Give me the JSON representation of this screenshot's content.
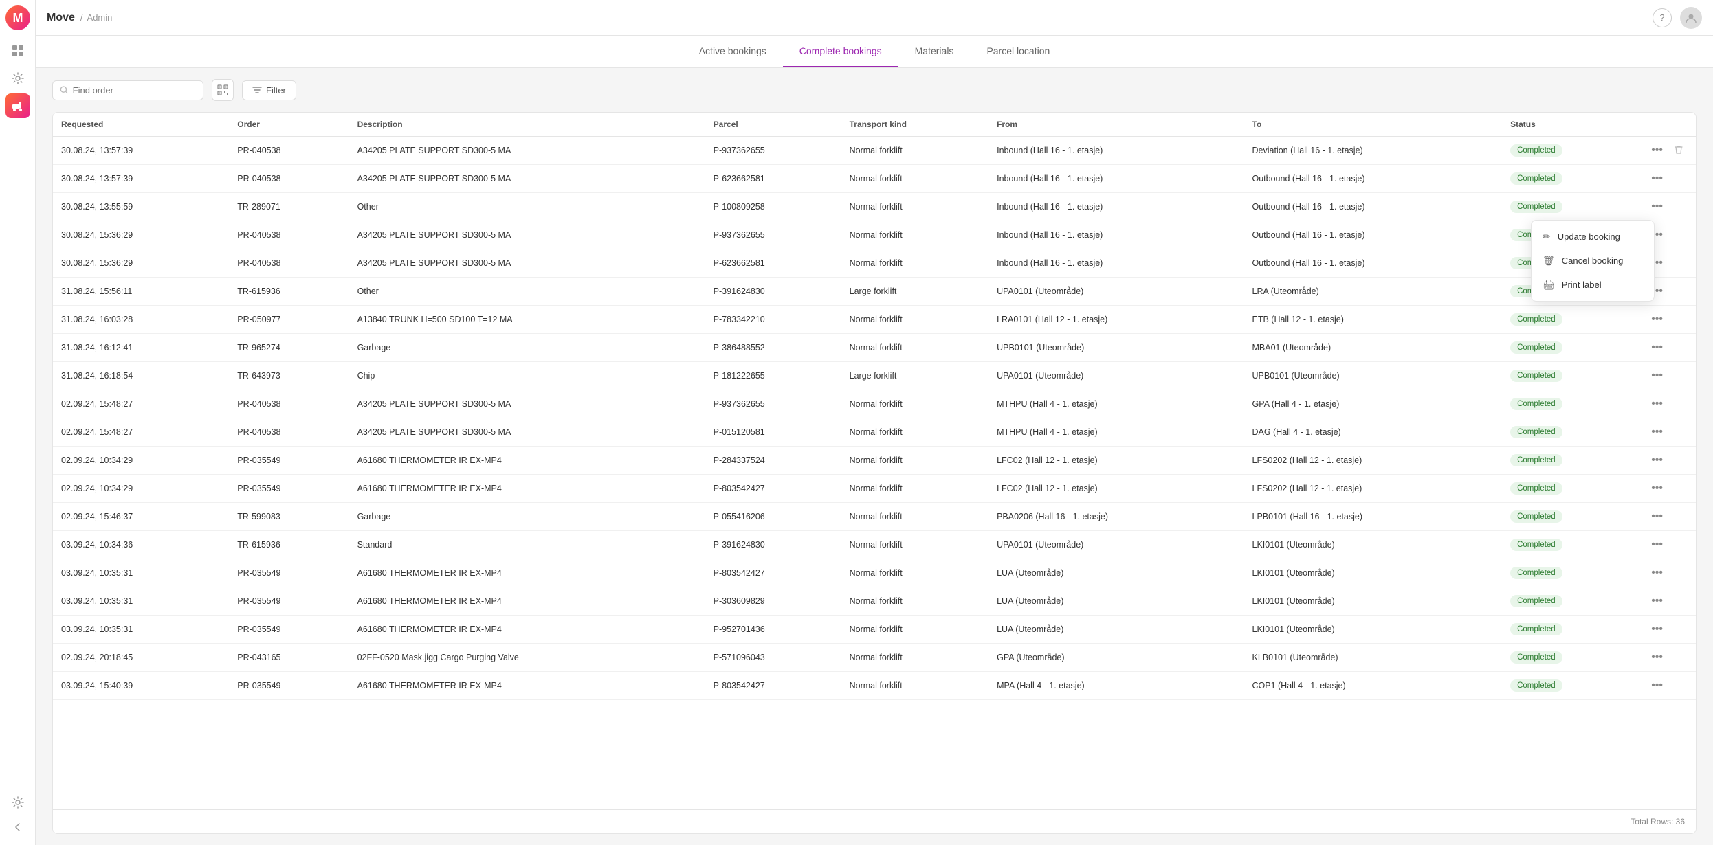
{
  "app": {
    "name": "Move",
    "breadcrumb_sep": "/",
    "breadcrumb": "Admin"
  },
  "sidebar": {
    "logo_alt": "Move logo",
    "icons": [
      {
        "name": "grid-icon",
        "symbol": "⊞",
        "active": false
      },
      {
        "name": "settings-icon",
        "symbol": "⚙",
        "active": false
      },
      {
        "name": "forklift-icon",
        "symbol": "🏗",
        "active": true
      },
      {
        "name": "gear-bottom-icon",
        "symbol": "⚙",
        "active": false
      },
      {
        "name": "collapse-icon",
        "symbol": "‹",
        "active": false
      }
    ]
  },
  "topbar": {
    "help_icon": "?",
    "user_icon": "👤"
  },
  "nav": {
    "tabs": [
      {
        "id": "active",
        "label": "Active bookings",
        "active": false
      },
      {
        "id": "complete",
        "label": "Complete bookings",
        "active": true
      },
      {
        "id": "materials",
        "label": "Materials",
        "active": false
      },
      {
        "id": "parcel",
        "label": "Parcel location",
        "active": false
      }
    ]
  },
  "toolbar": {
    "search_placeholder": "Find order",
    "filter_label": "Filter",
    "qr_title": "QR"
  },
  "table": {
    "columns": [
      "Requested",
      "Order",
      "Description",
      "Parcel",
      "Transport kind",
      "From",
      "To",
      "Status"
    ],
    "rows": [
      {
        "requested": "30.08.24, 13:57:39",
        "order": "PR-040538",
        "description": "A34205 PLATE SUPPORT SD300-5 MA",
        "parcel": "P-937362655",
        "transport": "Normal forklift",
        "from": "Inbound (Hall 16 - 1. etasje)",
        "to": "Deviation (Hall 16 - 1. etasje)",
        "status": "Completed",
        "menu_open": true
      },
      {
        "requested": "30.08.24, 13:57:39",
        "order": "PR-040538",
        "description": "A34205 PLATE SUPPORT SD300-5 MA",
        "parcel": "P-623662581",
        "transport": "Normal forklift",
        "from": "Inbound (Hall 16 - 1. etasje)",
        "to": "Outbound (Hall 16 - 1. etasje)",
        "status": "Completed",
        "menu_open": false
      },
      {
        "requested": "30.08.24, 13:55:59",
        "order": "TR-289071",
        "description": "Other",
        "parcel": "P-100809258",
        "transport": "Normal forklift",
        "from": "Inbound (Hall 16 - 1. etasje)",
        "to": "Outbound (Hall 16 - 1. etasje)",
        "status": "Completed",
        "menu_open": false
      },
      {
        "requested": "30.08.24, 15:36:29",
        "order": "PR-040538",
        "description": "A34205 PLATE SUPPORT SD300-5 MA",
        "parcel": "P-937362655",
        "transport": "Normal forklift",
        "from": "Inbound (Hall 16 - 1. etasje)",
        "to": "Outbound (Hall 16 - 1. etasje)",
        "status": "Completed",
        "menu_open": false
      },
      {
        "requested": "30.08.24, 15:36:29",
        "order": "PR-040538",
        "description": "A34205 PLATE SUPPORT SD300-5 MA",
        "parcel": "P-623662581",
        "transport": "Normal forklift",
        "from": "Inbound (Hall 16 - 1. etasje)",
        "to": "Outbound (Hall 16 - 1. etasje)",
        "status": "Completed",
        "menu_open": false
      },
      {
        "requested": "31.08.24, 15:56:11",
        "order": "TR-615936",
        "description": "Other",
        "parcel": "P-391624830",
        "transport": "Large forklift",
        "from": "UPA0101 (Uteområde)",
        "to": "LRA (Uteområde)",
        "status": "Completed",
        "menu_open": false
      },
      {
        "requested": "31.08.24, 16:03:28",
        "order": "PR-050977",
        "description": "A13840 TRUNK H=500 SD100 T=12 MA",
        "parcel": "P-783342210",
        "transport": "Normal forklift",
        "from": "LRA0101 (Hall 12 - 1. etasje)",
        "to": "ETB (Hall 12 - 1. etasje)",
        "status": "Completed",
        "menu_open": false
      },
      {
        "requested": "31.08.24, 16:12:41",
        "order": "TR-965274",
        "description": "Garbage",
        "parcel": "P-386488552",
        "transport": "Normal forklift",
        "from": "UPB0101 (Uteområde)",
        "to": "MBA01 (Uteområde)",
        "status": "Completed",
        "menu_open": false
      },
      {
        "requested": "31.08.24, 16:18:54",
        "order": "TR-643973",
        "description": "Chip",
        "parcel": "P-181222655",
        "transport": "Large forklift",
        "from": "UPA0101 (Uteområde)",
        "to": "UPB0101 (Uteområde)",
        "status": "Completed",
        "menu_open": false
      },
      {
        "requested": "02.09.24, 15:48:27",
        "order": "PR-040538",
        "description": "A34205 PLATE SUPPORT SD300-5 MA",
        "parcel": "P-937362655",
        "transport": "Normal forklift",
        "from": "MTHPU (Hall 4 - 1. etasje)",
        "to": "GPA (Hall 4 - 1. etasje)",
        "status": "Completed",
        "menu_open": false
      },
      {
        "requested": "02.09.24, 15:48:27",
        "order": "PR-040538",
        "description": "A34205 PLATE SUPPORT SD300-5 MA",
        "parcel": "P-015120581",
        "transport": "Normal forklift",
        "from": "MTHPU (Hall 4 - 1. etasje)",
        "to": "DAG (Hall 4 - 1. etasje)",
        "status": "Completed",
        "menu_open": false
      },
      {
        "requested": "02.09.24, 10:34:29",
        "order": "PR-035549",
        "description": "A61680 THERMOMETER IR EX-MP4",
        "parcel": "P-284337524",
        "transport": "Normal forklift",
        "from": "LFC02 (Hall 12 - 1. etasje)",
        "to": "LFS0202 (Hall 12 - 1. etasje)",
        "status": "Completed",
        "menu_open": false
      },
      {
        "requested": "02.09.24, 10:34:29",
        "order": "PR-035549",
        "description": "A61680 THERMOMETER IR EX-MP4",
        "parcel": "P-803542427",
        "transport": "Normal forklift",
        "from": "LFC02 (Hall 12 - 1. etasje)",
        "to": "LFS0202 (Hall 12 - 1. etasje)",
        "status": "Completed",
        "menu_open": false
      },
      {
        "requested": "02.09.24, 15:46:37",
        "order": "TR-599083",
        "description": "Garbage",
        "parcel": "P-055416206",
        "transport": "Normal forklift",
        "from": "PBA0206 (Hall 16 - 1. etasje)",
        "to": "LPB0101 (Hall 16 - 1. etasje)",
        "status": "Completed",
        "menu_open": false
      },
      {
        "requested": "03.09.24, 10:34:36",
        "order": "TR-615936",
        "description": "Standard",
        "parcel": "P-391624830",
        "transport": "Normal forklift",
        "from": "UPA0101 (Uteområde)",
        "to": "LKI0101 (Uteområde)",
        "status": "Completed",
        "menu_open": false
      },
      {
        "requested": "03.09.24, 10:35:31",
        "order": "PR-035549",
        "description": "A61680 THERMOMETER IR EX-MP4",
        "parcel": "P-803542427",
        "transport": "Normal forklift",
        "from": "LUA (Uteområde)",
        "to": "LKI0101 (Uteområde)",
        "status": "Completed",
        "menu_open": false
      },
      {
        "requested": "03.09.24, 10:35:31",
        "order": "PR-035549",
        "description": "A61680 THERMOMETER IR EX-MP4",
        "parcel": "P-303609829",
        "transport": "Normal forklift",
        "from": "LUA (Uteområde)",
        "to": "LKI0101 (Uteområde)",
        "status": "Completed",
        "menu_open": false
      },
      {
        "requested": "03.09.24, 10:35:31",
        "order": "PR-035549",
        "description": "A61680 THERMOMETER IR EX-MP4",
        "parcel": "P-952701436",
        "transport": "Normal forklift",
        "from": "LUA (Uteområde)",
        "to": "LKI0101 (Uteområde)",
        "status": "Completed",
        "menu_open": false
      },
      {
        "requested": "02.09.24, 20:18:45",
        "order": "PR-043165",
        "description": "02FF-0520 Mask.jigg Cargo Purging Valve",
        "parcel": "P-571096043",
        "transport": "Normal forklift",
        "from": "GPA (Uteområde)",
        "to": "KLB0101 (Uteområde)",
        "status": "Completed",
        "menu_open": false
      },
      {
        "requested": "03.09.24, 15:40:39",
        "order": "PR-035549",
        "description": "A61680 THERMOMETER IR EX-MP4",
        "parcel": "P-803542427",
        "transport": "Normal forklift",
        "from": "MPA (Hall 4 - 1. etasje)",
        "to": "COP1 (Hall 4 - 1. etasje)",
        "status": "Completed",
        "menu_open": false
      }
    ],
    "total_rows_label": "Total Rows: 36"
  },
  "context_menu": {
    "items": [
      {
        "icon": "edit-icon",
        "symbol": "✏",
        "label": "Update booking"
      },
      {
        "icon": "trash-icon",
        "symbol": "🗑",
        "label": "Cancel booking"
      },
      {
        "icon": "print-icon",
        "symbol": "🖨",
        "label": "Print label"
      }
    ]
  },
  "colors": {
    "active_tab": "#9c27b0",
    "status_bg": "#e8f5e9",
    "status_text": "#2e7d32",
    "logo_gradient_start": "#ff6b35",
    "logo_gradient_end": "#e91e8c"
  }
}
